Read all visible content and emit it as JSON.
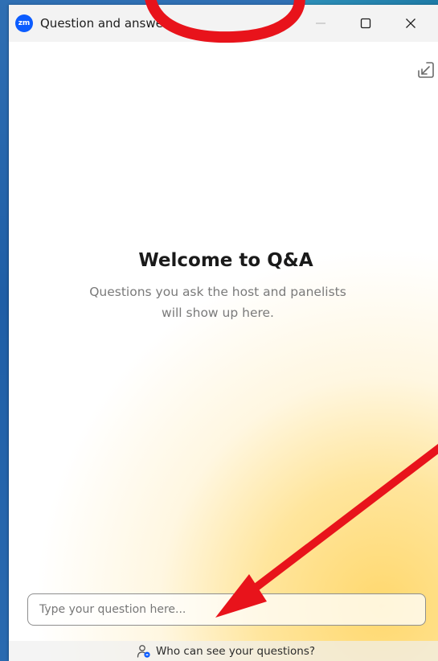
{
  "window": {
    "title": "Question and answer",
    "logo_text": "zm",
    "minimize_icon": "minimize-icon",
    "maximize_icon": "maximize-icon",
    "close_icon": "close-icon"
  },
  "toolbar": {
    "popout_icon": "popout-arrow-icon"
  },
  "welcome": {
    "title": "Welcome to Q&A",
    "subtitle_line1": "Questions you ask the host and panelists",
    "subtitle_line2": "will show up here."
  },
  "input": {
    "placeholder": "Type your question here...",
    "value": ""
  },
  "footer": {
    "label": "Who can see your questions?",
    "icon": "person-visibility-icon"
  },
  "colors": {
    "brand": "#0b5cff",
    "annotation": "#e8131b",
    "highlight": "#ffd666"
  }
}
